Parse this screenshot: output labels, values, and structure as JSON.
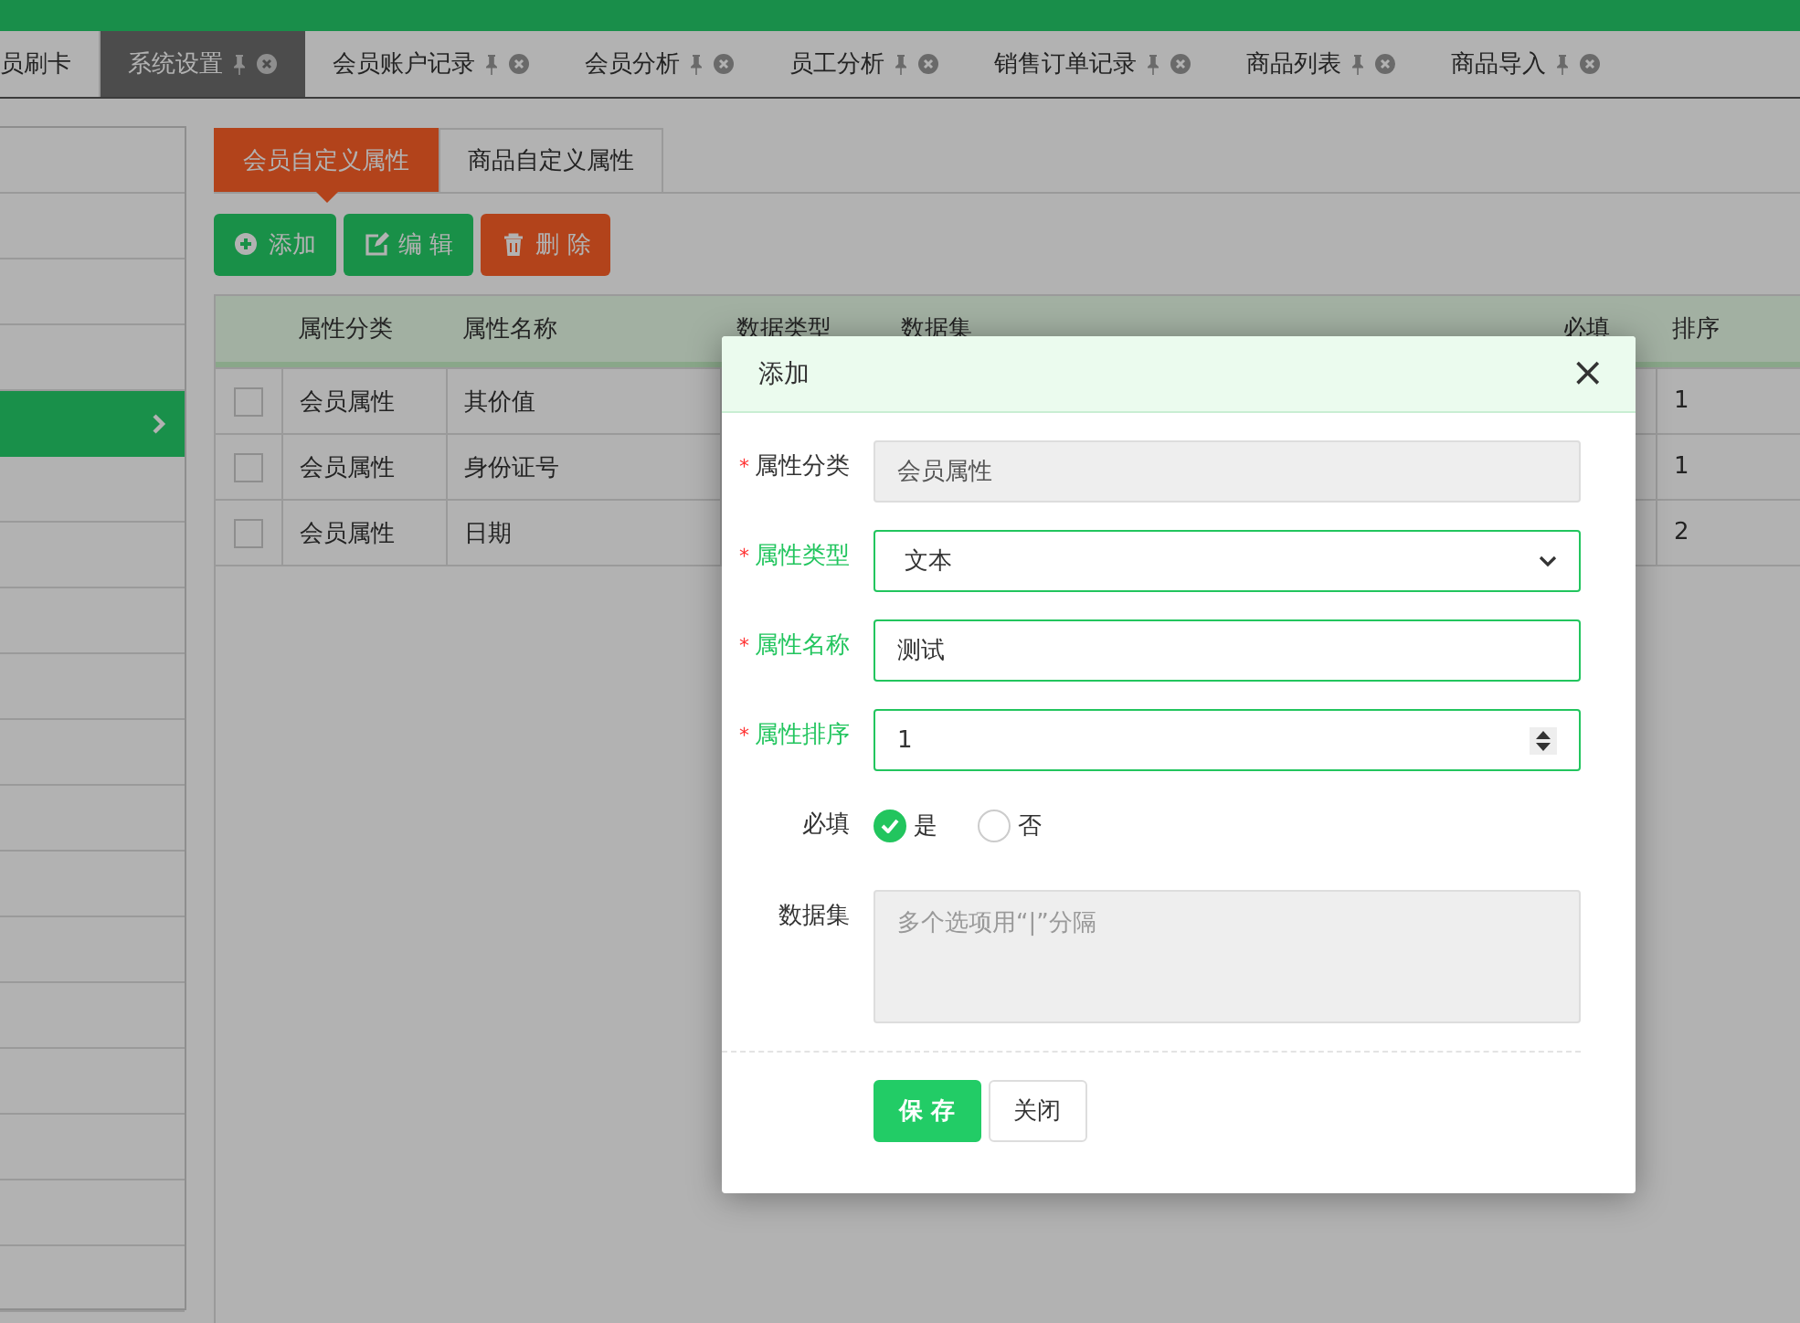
{
  "top_tabs": [
    {
      "label": "员刷卡",
      "selected": false,
      "closable": false
    },
    {
      "label": "系统设置",
      "selected": true,
      "closable": true
    },
    {
      "label": "会员账户记录",
      "selected": false,
      "closable": true
    },
    {
      "label": "会员分析",
      "selected": false,
      "closable": true
    },
    {
      "label": "员工分析",
      "selected": false,
      "closable": true
    },
    {
      "label": "销售订单记录",
      "selected": false,
      "closable": true
    },
    {
      "label": "商品列表",
      "selected": false,
      "closable": true
    },
    {
      "label": "商品导入",
      "selected": false,
      "closable": true
    }
  ],
  "sidebar": {
    "items": [
      {
        "selected": false
      },
      {
        "selected": false
      },
      {
        "selected": false
      },
      {
        "selected": false
      },
      {
        "selected": true
      },
      {
        "selected": false
      },
      {
        "selected": false
      },
      {
        "selected": false
      },
      {
        "selected": false
      },
      {
        "selected": false
      },
      {
        "selected": false
      },
      {
        "selected": false
      },
      {
        "selected": false
      },
      {
        "selected": false
      },
      {
        "selected": false
      },
      {
        "selected": false
      },
      {
        "selected": false
      },
      {
        "selected": false
      }
    ]
  },
  "sub_tabs": [
    {
      "label": "会员自定义属性",
      "selected": true
    },
    {
      "label": "商品自定义属性",
      "selected": false
    }
  ],
  "toolbar": [
    {
      "label": "添加",
      "kind": "add"
    },
    {
      "label": "编 辑",
      "kind": "edit"
    },
    {
      "label": "删 除",
      "kind": "delete"
    }
  ],
  "table": {
    "columns": [
      "属性分类",
      "属性名称",
      "数据类型",
      "数据集",
      "必填",
      "排序"
    ],
    "rows": [
      {
        "checked": false,
        "cells": [
          "会员属性",
          "其价值",
          "",
          "",
          "",
          "1"
        ]
      },
      {
        "checked": false,
        "cells": [
          "会员属性",
          "身份证号",
          "",
          "",
          "",
          "1"
        ]
      },
      {
        "checked": false,
        "cells": [
          "会员属性",
          "日期",
          "",
          "",
          "",
          "2"
        ]
      }
    ]
  },
  "dialog": {
    "title": "添加",
    "close": "×",
    "fields": [
      {
        "label": "属性分类",
        "marker": "*",
        "valid": false,
        "kind": "readonly",
        "value": "会员属性"
      },
      {
        "label": "属性类型",
        "marker": "*",
        "valid": true,
        "kind": "select",
        "value": "文本"
      },
      {
        "label": "属性名称",
        "marker": "*",
        "valid": true,
        "kind": "text",
        "value": "测试"
      },
      {
        "label": "属性排序",
        "marker": "*",
        "valid": true,
        "kind": "number",
        "value": "1"
      },
      {
        "label": "必填",
        "valid": false,
        "kind": "radio",
        "options": [
          {
            "label": "是",
            "selected": true
          },
          {
            "label": "否",
            "selected": false
          }
        ]
      },
      {
        "label": "数据集",
        "valid": false,
        "kind": "textarea",
        "placeholder": "多个选项用“|”分隔"
      }
    ],
    "buttons": [
      {
        "label": "保 存",
        "kind": "primary"
      },
      {
        "label": "关闭",
        "kind": "default"
      }
    ]
  }
}
